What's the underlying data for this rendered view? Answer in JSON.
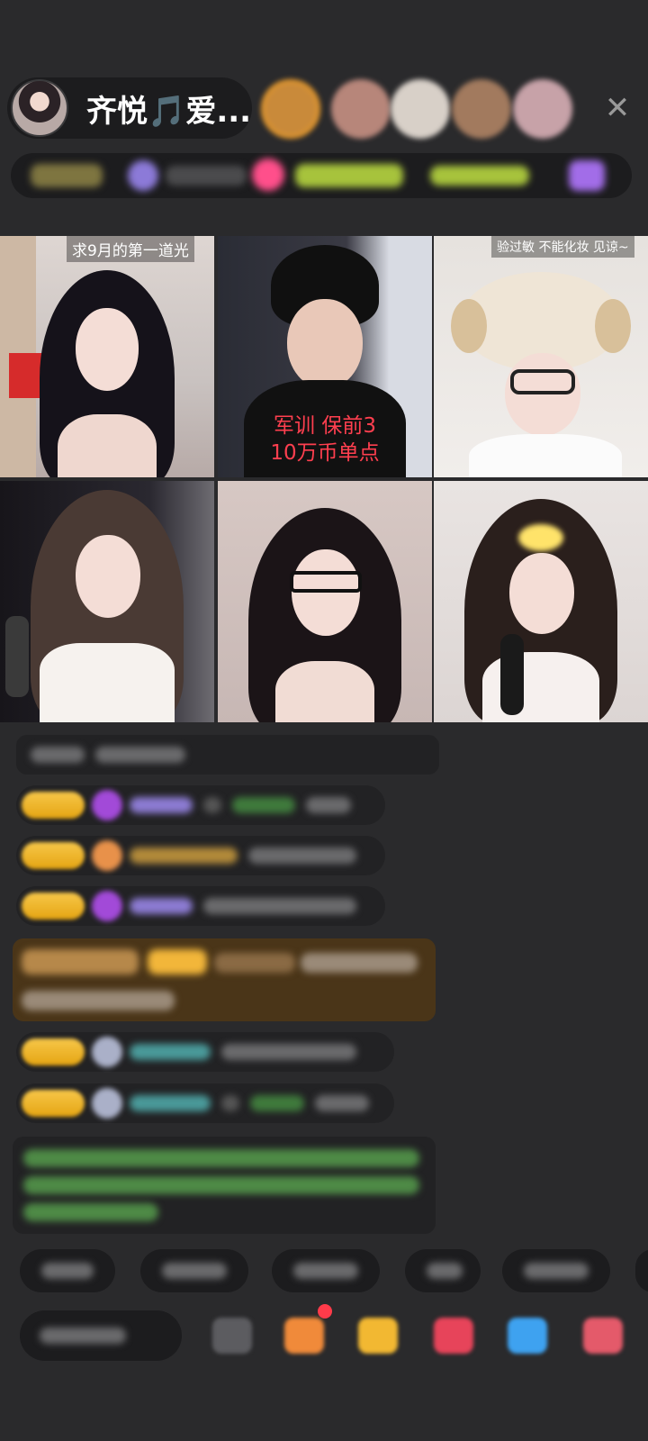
{
  "host": {
    "name": "齐悦🎵爱..."
  },
  "close_icon": "close-icon",
  "video_grid": [
    {
      "caption": "求9月的第一道光"
    },
    {
      "caption": "军训 保前3\n10万币单点"
    },
    {
      "caption": "验过敏 不能化妆 见谅~"
    },
    {
      "caption": ""
    },
    {
      "caption": ""
    },
    {
      "caption": ""
    }
  ],
  "colors": {
    "background": "#2a2a2c",
    "pill": "#1c1c1e",
    "red_caption": "#ff3f4f",
    "gold_badge": "#f1b72c"
  }
}
